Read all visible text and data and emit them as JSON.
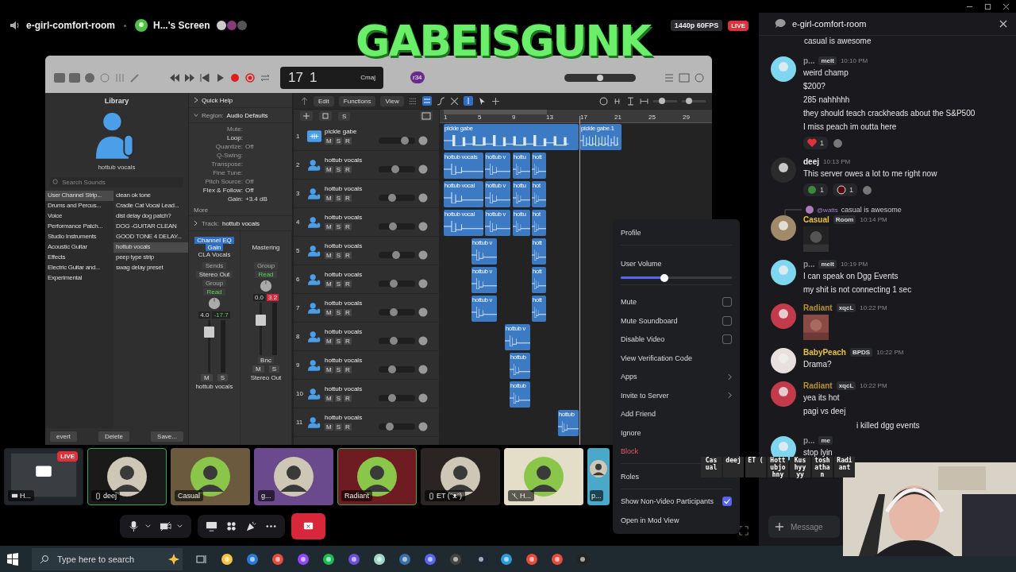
{
  "stream_header": {
    "channel": "e-girl-comfort-room",
    "screen_title": "H...'s Screen",
    "quality": "1440p 60FPS",
    "live": "LIVE"
  },
  "overlay_logo": "GABEISGUNK",
  "logic": {
    "lcd": {
      "bar": "17",
      "beat": "1",
      "key": "Cmaj"
    },
    "user_badge": "r34",
    "master_volume": {
      "level": 0.5
    },
    "zoom_sliders": [
      {
        "level": 0.35
      },
      {
        "level": 0.3
      }
    ],
    "library": {
      "title": "Library",
      "patch_name": "hottub vocals",
      "search_placeholder": "Search Sounds",
      "categories": [
        {
          "label": "User Channel Strip...",
          "selected": true
        },
        {
          "label": "Drums and Percus...",
          "selected": false
        },
        {
          "label": "Voice",
          "selected": false
        },
        {
          "label": "Performance Patch...",
          "selected": false
        },
        {
          "label": "Studio Instruments",
          "selected": false
        },
        {
          "label": "Acoustic Guitar",
          "selected": false
        },
        {
          "label": "Effects",
          "selected": false
        },
        {
          "label": "Electric Guitar and...",
          "selected": false
        },
        {
          "label": "Experimental",
          "selected": false
        }
      ],
      "patches": [
        {
          "label": "clean ok tone",
          "selected": false
        },
        {
          "label": "Cradle Cat Vocal Lead...",
          "selected": false
        },
        {
          "label": "dist delay dog patch?",
          "selected": false
        },
        {
          "label": "DOG -GUITAR CLEAN",
          "selected": false
        },
        {
          "label": "GOOD TONE 4 DELAY...",
          "selected": false
        },
        {
          "label": "hottub vocals",
          "selected": true
        },
        {
          "label": "peep type strip",
          "selected": false
        },
        {
          "label": "swag delay preset",
          "selected": false
        }
      ],
      "buttons": [
        "evert",
        "Delete",
        "Save..."
      ]
    },
    "inspector": {
      "quick_help": "Quick Help",
      "region_label": "Region:",
      "region": "Audio Defaults",
      "params": [
        {
          "label": "Mute:",
          "dim": true
        },
        {
          "label": "Loop:",
          "dim": false
        },
        {
          "label": "Quantize:",
          "value": "Off",
          "dim": true
        },
        {
          "label": "Q-Swing:",
          "dim": true
        },
        {
          "label": "Transpose:",
          "dim": true
        },
        {
          "label": "Fine Tune:",
          "dim": true
        },
        {
          "label": "Pitch Source:",
          "value": "Off",
          "dim": true
        },
        {
          "label": "Flex & Follow:",
          "value": "Off",
          "dim": false
        },
        {
          "label": "Gain:",
          "value": "+3.4 dB",
          "dim": false
        }
      ],
      "more": "More",
      "track_label": "Track:",
      "track": "hottub vocals",
      "strips": [
        {
          "plugins": [
            {
              "label": "Channel EQ",
              "selected": true
            },
            {
              "label": "Gain",
              "selected": true
            },
            {
              "label": "CLA Vocals",
              "selected": false
            }
          ],
          "sends": "Sends",
          "output": "Stereo Out",
          "group": "Group",
          "automation": "Read",
          "volume": "4.0",
          "peak": "-17.7",
          "clipping": false,
          "level": 0.85,
          "mute": "M",
          "solo": "S",
          "name": "hottub vocals"
        },
        {
          "plugins": [
            {
              "label": "Mastering",
              "selected": false
            }
          ],
          "group": "Group",
          "automation": "Read",
          "volume": "0.0",
          "peak": "3.2",
          "clipping": true,
          "level": 0.72,
          "bounce": "Bnc",
          "mute": "M",
          "solo": "S",
          "name": "Stereo Out"
        }
      ]
    },
    "menus": [
      "Edit",
      "Functions",
      "View"
    ],
    "solo_button": "S",
    "ruler": [
      "1",
      "5",
      "9",
      "13",
      "17",
      "21",
      "25",
      "29"
    ],
    "tracks": [
      {
        "num": "1",
        "name": "pickle gabe",
        "kind": "audio",
        "buttons": [
          "M",
          "S",
          "R"
        ],
        "level": 0.72,
        "regions": [
          "pickle gabe",
          "pickle gabe.1"
        ]
      },
      {
        "num": "2",
        "name": "hottub vocals",
        "kind": "vocal",
        "buttons": [
          "M",
          "S",
          "R"
        ],
        "level": 0.45,
        "regions": [
          "hottub vocals",
          "hottub v",
          "hottu",
          "hott"
        ]
      },
      {
        "num": "3",
        "name": "hottub vocals",
        "kind": "vocal",
        "buttons": [
          "M",
          "S",
          "R"
        ],
        "level": 0.37,
        "regions": [
          "hottub vocal",
          "hottub v",
          "hottu",
          "hot"
        ]
      },
      {
        "num": "4",
        "name": "hottub vocals",
        "kind": "vocal",
        "buttons": [
          "M",
          "S",
          "R"
        ],
        "level": 0.4,
        "regions": [
          "hottub vocal",
          "hottub v",
          "hottu",
          "hot"
        ]
      },
      {
        "num": "5",
        "name": "hottub vocals",
        "kind": "vocal",
        "buttons": [
          "M",
          "S",
          "R"
        ],
        "level": 0.47,
        "regions": [
          "hottub v",
          "hott"
        ]
      },
      {
        "num": "6",
        "name": "hottub vocals",
        "kind": "vocal",
        "buttons": [
          "M",
          "S",
          "R"
        ],
        "level": 0.42,
        "regions": [
          "hottub v",
          "hott"
        ]
      },
      {
        "num": "7",
        "name": "hottub vocals",
        "kind": "vocal",
        "buttons": [
          "M",
          "S",
          "R"
        ],
        "level": 0.42,
        "regions": [
          "hottub v",
          "hott"
        ]
      },
      {
        "num": "8",
        "name": "hottub vocals",
        "kind": "vocal",
        "buttons": [
          "M",
          "S",
          "R"
        ],
        "level": 0.42,
        "regions": [
          "hottub v"
        ]
      },
      {
        "num": "9",
        "name": "hottub vocals",
        "kind": "vocal",
        "buttons": [
          "M",
          "S",
          "R"
        ],
        "level": 0.38,
        "regions": [
          "hottub"
        ]
      },
      {
        "num": "10",
        "name": "hottub vocals",
        "kind": "vocal",
        "buttons": [
          "M",
          "S",
          "R"
        ],
        "level": 0.37,
        "regions": [
          "hottub"
        ]
      },
      {
        "num": "11",
        "name": "hottub vocals",
        "kind": "vocal",
        "buttons": [
          "M",
          "S",
          "R"
        ],
        "level": 0.3,
        "regions": [
          "hottub"
        ]
      }
    ]
  },
  "participants": [
    {
      "kind": "screen",
      "name": "H...",
      "live": "LIVE",
      "speaking": false,
      "color": "#1c1f24"
    },
    {
      "kind": "phone",
      "name": "deej",
      "speaking": true,
      "color": "#1a1a1a"
    },
    {
      "kind": "user",
      "name": "Casual",
      "speaking": false,
      "color": "#6b5a3e"
    },
    {
      "kind": "user",
      "name": "g...",
      "speaking": false,
      "color": "#6a4a8c"
    },
    {
      "kind": "user",
      "name": "Radiant",
      "speaking": true,
      "color": "#6e1c22"
    },
    {
      "kind": "phone",
      "name": "ET (ᵔᴥᵔ)",
      "speaking": false,
      "color": "#2a2522"
    },
    {
      "kind": "muted",
      "name": "H...",
      "speaking": false,
      "color": "#e4ddc8"
    },
    {
      "kind": "user",
      "name": "p...",
      "speaking": false,
      "color": "#4aa8c8"
    }
  ],
  "overlay_names": [
    "Cas ual",
    "deej",
    "ET (",
    "Hott ubjo hny",
    "Kus hyy yy",
    "tosh atha n",
    "Radi ant"
  ],
  "context_menu": [
    {
      "kind": "item",
      "label": "Profile",
      "separator": true
    },
    {
      "kind": "slider",
      "label": "User Volume",
      "level": 0.39,
      "separator": true
    },
    {
      "kind": "checkbox",
      "label": "Mute",
      "checked": false,
      "separator": false
    },
    {
      "kind": "checkbox",
      "label": "Mute Soundboard",
      "checked": false,
      "separator": false
    },
    {
      "kind": "checkbox",
      "label": "Disable Video",
      "checked": false,
      "separator": false
    },
    {
      "kind": "item",
      "label": "View Verification Code",
      "separator": false
    },
    {
      "kind": "submenu",
      "label": "Apps",
      "separator": false
    },
    {
      "kind": "submenu",
      "label": "Invite to Server",
      "separator": false
    },
    {
      "kind": "item",
      "label": "Add Friend",
      "separator": false
    },
    {
      "kind": "item",
      "label": "Ignore",
      "separator": false
    },
    {
      "kind": "danger",
      "label": "Block",
      "separator": true
    },
    {
      "kind": "item",
      "label": "Roles",
      "separator": true
    },
    {
      "kind": "checkbox",
      "label": "Show Non-Video Participants",
      "checked": true,
      "separator": false
    },
    {
      "kind": "item",
      "label": "Open in Mod View",
      "separator": false
    }
  ],
  "chat": {
    "channel": "e-girl-comfort-room",
    "placeholder": "Message",
    "messages": [
      {
        "kind": "continuation",
        "lines": [
          "casual is awesome"
        ]
      },
      {
        "kind": "message",
        "author": "p...",
        "color": "#8e9097",
        "badge": "melt",
        "time": "10:10 PM",
        "lines": [
          "weird champ",
          "$200?",
          "285 nahhhhh",
          "they should teach crackheads about the S&P500",
          "I miss peach im outta here"
        ],
        "reactions": [
          {
            "kind": "heart",
            "count": "1"
          }
        ]
      },
      {
        "kind": "message",
        "author": "deej",
        "color": "#f2f3f5",
        "time": "10:13 PM",
        "lines": [
          "This server owes a lot to me right now"
        ],
        "reactions": [
          {
            "kind": "frog",
            "count": "1"
          },
          {
            "kind": "orb",
            "count": "1"
          }
        ]
      },
      {
        "kind": "message",
        "author": "Casual",
        "color": "#e8c13c",
        "badge": "Room",
        "time": "10:14 PM",
        "reply": {
          "author": "@watts",
          "text": "casual is awesome"
        }
      },
      {
        "kind": "message",
        "author": "p...",
        "color": "#8e9097",
        "badge": "melt",
        "time": "10:19 PM",
        "lines": [
          "I can speak on Dgg Events",
          "my shit is  not connecting 1 sec"
        ]
      },
      {
        "kind": "message",
        "author": "Radiant",
        "color": "#b8902f",
        "badge": "xqcL",
        "time": "10:22 PM"
      },
      {
        "kind": "message",
        "author": "BabyPeach",
        "color": "#e8c13c",
        "badge": "BPDS",
        "time": "10:22 PM",
        "lines": [
          "Drama?"
        ]
      },
      {
        "kind": "message",
        "author": "Radiant",
        "color": "#b8902f",
        "badge": "xqcL",
        "time": "10:22 PM",
        "lines": [
          "yea its hot",
          "pagi vs deej"
        ]
      },
      {
        "kind": "covered",
        "lines": [
          "i killed dgg events"
        ]
      },
      {
        "kind": "message",
        "author": "p...",
        "color": "#8e9097",
        "badge": "me",
        "lines": [
          "stop lyin"
        ]
      }
    ]
  },
  "taskbar": {
    "search_placeholder": "Type here to search"
  }
}
